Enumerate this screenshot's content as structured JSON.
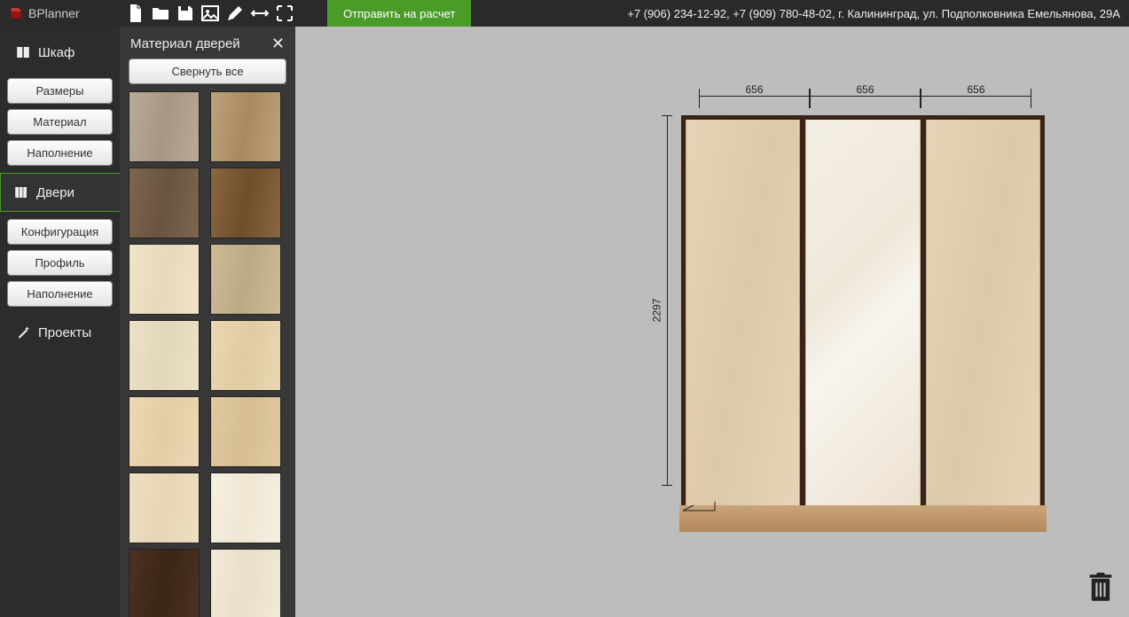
{
  "app_name": "BPlanner",
  "top_actions": {
    "send_for_calc": "Отправить на расчет",
    "contact": "+7 (906) 234-12-92, +7 (909) 780-48-02, г. Калининград, ул. Подполковника Емельянова, 29А"
  },
  "sidebar": {
    "section_wardrobe": "Шкаф",
    "wardrobe_sub": {
      "sizes": "Размеры",
      "material": "Материал",
      "filling": "Наполнение"
    },
    "section_doors": "Двери",
    "doors_sub": {
      "config": "Конфигурация",
      "profile": "Профиль",
      "filling": "Наполнение"
    },
    "section_projects": "Проекты"
  },
  "panel": {
    "title": "Материал дверей",
    "collapse_all": "Свернуть все",
    "swatches": [
      {
        "c1": "#b9a995",
        "c2": "#a79882"
      },
      {
        "c1": "#bda27a",
        "c2": "#a98a60"
      },
      {
        "c1": "#7d6650",
        "c2": "#6a543f"
      },
      {
        "c1": "#8a6640",
        "c2": "#6f4e2c"
      },
      {
        "c1": "#f0e3c8",
        "c2": "#e7d9bb"
      },
      {
        "c1": "#cdbb96",
        "c2": "#bbaa86"
      },
      {
        "c1": "#ece1c7",
        "c2": "#e3d7ba"
      },
      {
        "c1": "#ead7b0",
        "c2": "#e0cba3"
      },
      {
        "c1": "#ecd8b3",
        "c2": "#e3cda5"
      },
      {
        "c1": "#e0c9a0",
        "c2": "#d6bd93"
      },
      {
        "c1": "#eedfc2",
        "c2": "#e6d6b6"
      },
      {
        "c1": "#f6f0e1",
        "c2": "#efe7d3"
      },
      {
        "c1": "#4c3222",
        "c2": "#3b2517"
      },
      {
        "c1": "#f2ead7",
        "c2": "#eadfc8"
      }
    ]
  },
  "wardrobe": {
    "top_dims": [
      "656",
      "656",
      "656"
    ],
    "height": "2297"
  }
}
